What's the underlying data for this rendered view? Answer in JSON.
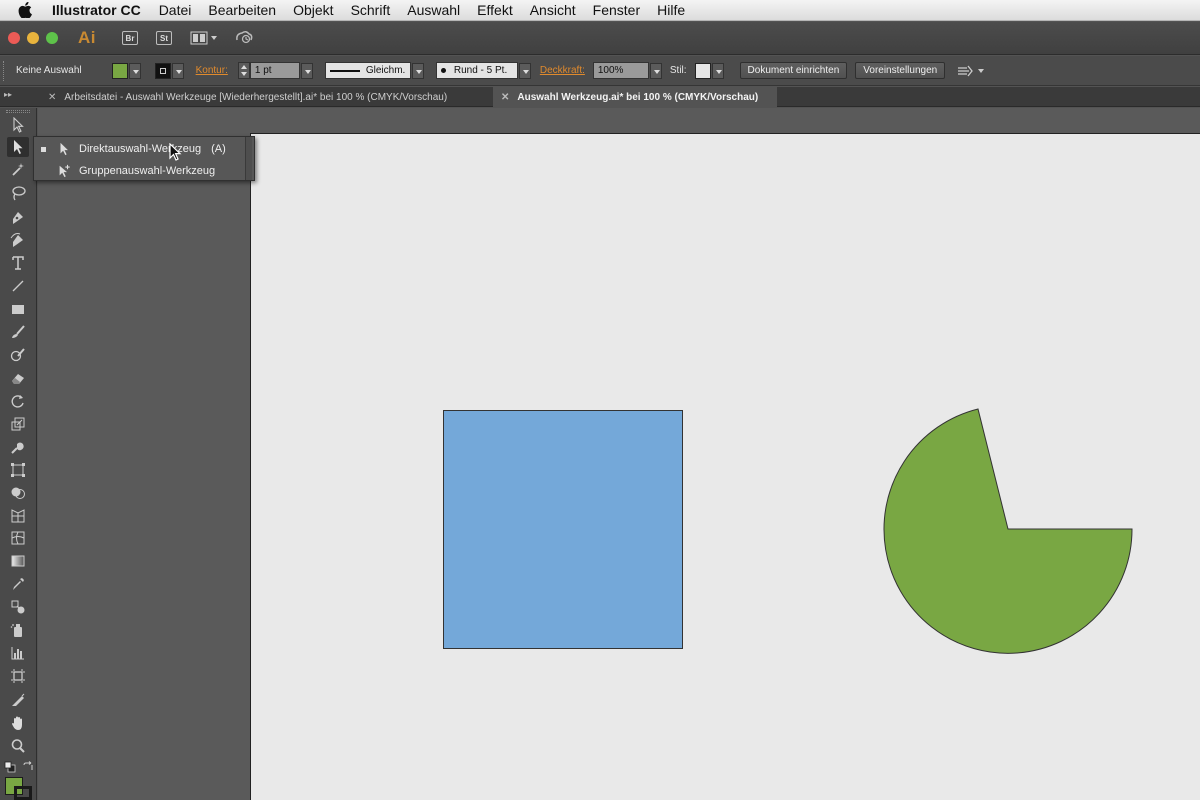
{
  "menubar": {
    "app_name": "Illustrator CC",
    "items": [
      "Datei",
      "Bearbeiten",
      "Objekt",
      "Schrift",
      "Auswahl",
      "Effekt",
      "Ansicht",
      "Fenster",
      "Hilfe"
    ]
  },
  "appbar": {
    "logo": "Ai",
    "bridge_label": "Br",
    "stock_label": "St"
  },
  "controlbar": {
    "selection_status": "Keine Auswahl",
    "fill_color": "#79a743",
    "stroke_label": "Kontur:",
    "stroke_weight": "1 pt",
    "profile_label": "Gleichm.",
    "brush_label": "Rund - 5 Pt.",
    "opacity_label": "Deckkraft:",
    "opacity_value": "100%",
    "style_label": "Stil:",
    "document_setup_button": "Dokument einrichten",
    "preferences_button": "Voreinstellungen"
  },
  "tabs": [
    {
      "label": "Arbeitsdatei - Auswahl Werkzeuge [Wiederhergestellt].ai* bei 100 % (CMYK/Vorschau)",
      "active": false
    },
    {
      "label": "Auswahl Werkzeug.ai* bei 100 % (CMYK/Vorschau)",
      "active": true
    }
  ],
  "flyout": {
    "items": [
      {
        "label": "Direktauswahl-Werkzeug",
        "shortcut": "(A)",
        "current": true
      },
      {
        "label": "Gruppenauswahl-Werkzeug",
        "shortcut": "",
        "current": false
      }
    ]
  },
  "canvas": {
    "square_color": "#74a8d9",
    "pie_color": "#79a743"
  }
}
